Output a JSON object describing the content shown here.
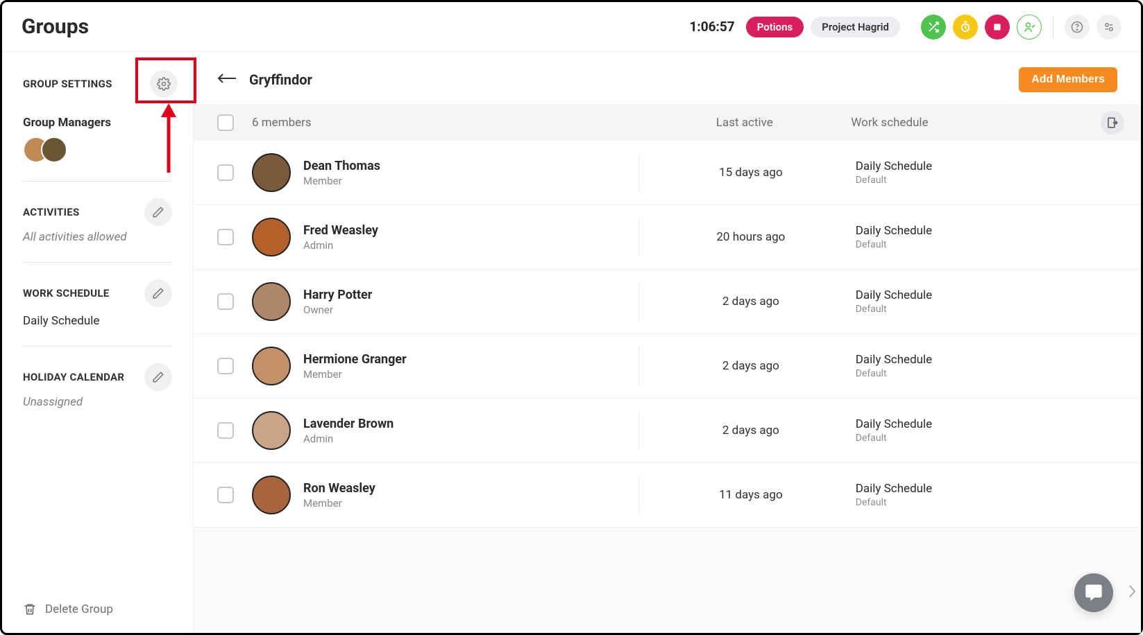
{
  "header": {
    "title": "Groups",
    "timer": "1:06:57",
    "pill_active": "Potions",
    "pill_project": "Project Hagrid"
  },
  "sidebar": {
    "settings_title": "GROUP SETTINGS",
    "managers_title": "Group Managers",
    "activities": {
      "title": "ACTIVITIES",
      "value": "All activities allowed"
    },
    "work_schedule": {
      "title": "WORK SCHEDULE",
      "value": "Daily Schedule"
    },
    "holiday": {
      "title": "HOLIDAY CALENDAR",
      "value": "Unassigned"
    },
    "delete": "Delete Group"
  },
  "content": {
    "group_name": "Gryffindor",
    "add_button": "Add Members",
    "members_count_label": "6 members",
    "cols": {
      "active": "Last active",
      "schedule": "Work schedule"
    }
  },
  "members": [
    {
      "name": "Dean Thomas",
      "role": "Member",
      "last_active": "15 days ago",
      "schedule": "Daily Schedule",
      "schedule_sub": "Default"
    },
    {
      "name": "Fred Weasley",
      "role": "Admin",
      "last_active": "20 hours ago",
      "schedule": "Daily Schedule",
      "schedule_sub": "Default"
    },
    {
      "name": "Harry Potter",
      "role": "Owner",
      "last_active": "2 days ago",
      "schedule": "Daily Schedule",
      "schedule_sub": "Default"
    },
    {
      "name": "Hermione Granger",
      "role": "Member",
      "last_active": "2 days ago",
      "schedule": "Daily Schedule",
      "schedule_sub": "Default"
    },
    {
      "name": "Lavender Brown",
      "role": "Admin",
      "last_active": "2 days ago",
      "schedule": "Daily Schedule",
      "schedule_sub": "Default"
    },
    {
      "name": "Ron Weasley",
      "role": "Member",
      "last_active": "11 days ago",
      "schedule": "Daily Schedule",
      "schedule_sub": "Default"
    }
  ]
}
